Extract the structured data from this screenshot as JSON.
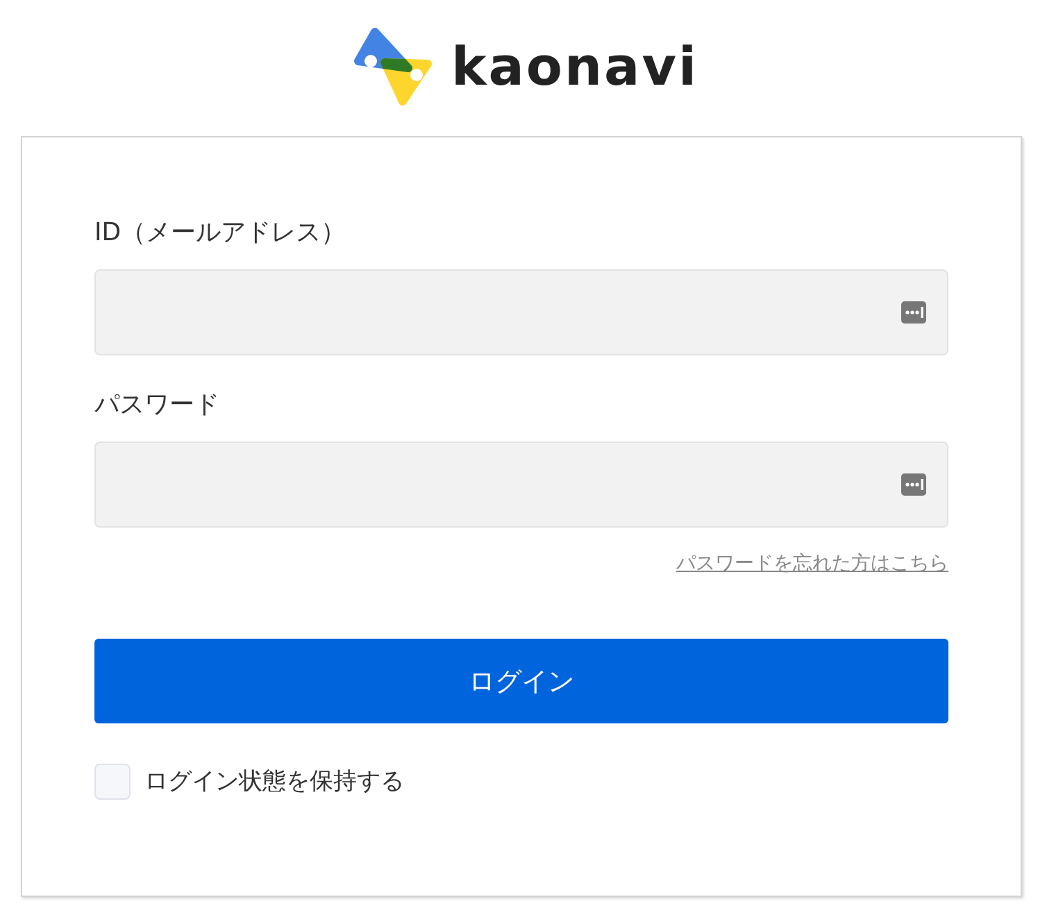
{
  "logo": {
    "wordmark": "kaonavi"
  },
  "form": {
    "fields": [
      {
        "label": "ID（メールアドレス）"
      },
      {
        "label": "パスワード"
      }
    ],
    "forgot_link": "パスワードを忘れた方はこちら",
    "submit_button": "ログイン",
    "remember": {
      "label": "ログイン状態を保持する",
      "checked": false
    }
  }
}
